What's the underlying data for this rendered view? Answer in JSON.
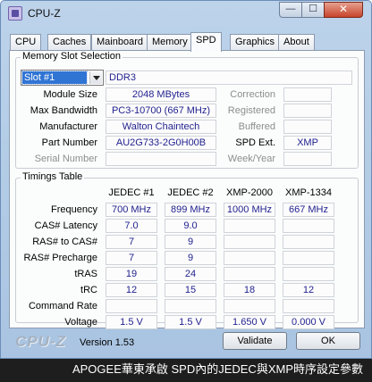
{
  "window": {
    "title": "CPU-Z"
  },
  "titlebar_buttons": {
    "minimize": "—",
    "maximize": "☐",
    "close": "✕"
  },
  "tabs": [
    "CPU",
    "Caches",
    "Mainboard",
    "Memory",
    "SPD",
    "Graphics",
    "About"
  ],
  "active_tab": "SPD",
  "memory_slot": {
    "group_title": "Memory Slot Selection",
    "slot_selected": "Slot #1",
    "type": "DDR3",
    "module_size_label": "Module Size",
    "module_size": "2048 MBytes",
    "max_bandwidth_label": "Max Bandwidth",
    "max_bandwidth": "PC3-10700 (667 MHz)",
    "manufacturer_label": "Manufacturer",
    "manufacturer": "Walton Chaintech",
    "part_number_label": "Part Number",
    "part_number": "AU2G733-2G0H00B",
    "serial_number_label": "Serial Number",
    "serial_number": "",
    "correction_label": "Correction",
    "correction": "",
    "registered_label": "Registered",
    "registered": "",
    "buffered_label": "Buffered",
    "buffered": "",
    "spd_ext_label": "SPD Ext.",
    "spd_ext": "XMP",
    "week_year_label": "Week/Year",
    "week_year": ""
  },
  "timings": {
    "group_title": "Timings Table",
    "columns": [
      "JEDEC #1",
      "JEDEC #2",
      "XMP-2000",
      "XMP-1334"
    ],
    "rows": [
      {
        "label": "Frequency",
        "values": [
          "700 MHz",
          "899 MHz",
          "1000 MHz",
          "667 MHz"
        ]
      },
      {
        "label": "CAS# Latency",
        "values": [
          "7.0",
          "9.0",
          "",
          ""
        ]
      },
      {
        "label": "RAS# to CAS#",
        "values": [
          "7",
          "9",
          "",
          ""
        ]
      },
      {
        "label": "RAS# Precharge",
        "values": [
          "7",
          "9",
          "",
          ""
        ]
      },
      {
        "label": "tRAS",
        "values": [
          "19",
          "24",
          "",
          ""
        ]
      },
      {
        "label": "tRC",
        "values": [
          "12",
          "15",
          "18",
          "12"
        ]
      },
      {
        "label": "Command Rate",
        "values": [
          "",
          "",
          "",
          ""
        ]
      },
      {
        "label": "Voltage",
        "values": [
          "1.5 V",
          "1.5 V",
          "1.650 V",
          "0.000 V"
        ]
      }
    ]
  },
  "footer": {
    "logo": "CPU-Z",
    "version": "Version 1.53",
    "validate_label": "Validate",
    "ok_label": "OK"
  },
  "caption": "APOGEE華東承啟 SPD內的JEDEC與XMP時序設定參數"
}
